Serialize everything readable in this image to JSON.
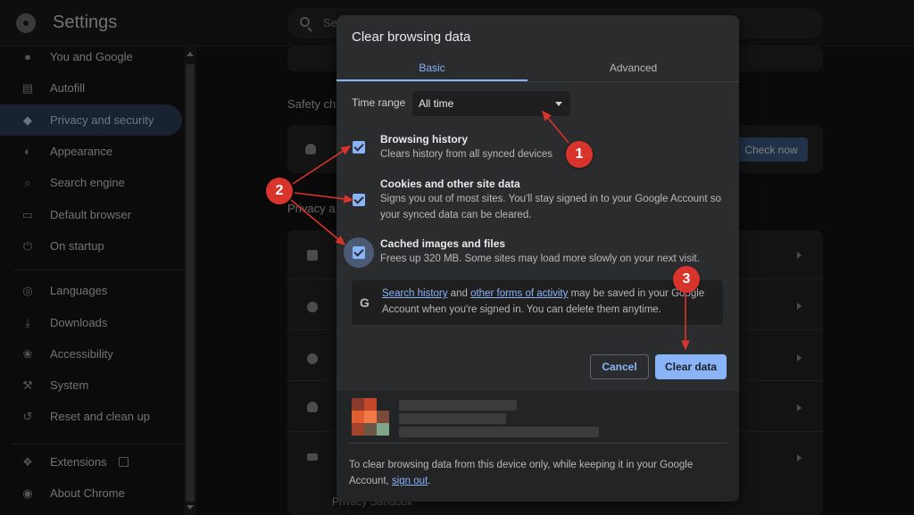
{
  "app": {
    "title": "Settings",
    "search_placeholder": "Search settings"
  },
  "sidebar": {
    "items": [
      {
        "label": "You and Google",
        "icon": "person-icon"
      },
      {
        "label": "Autofill",
        "icon": "clipboard-icon"
      },
      {
        "label": "Privacy and security",
        "icon": "shield-icon",
        "active": true
      },
      {
        "label": "Appearance",
        "icon": "palette-icon"
      },
      {
        "label": "Search engine",
        "icon": "search-icon"
      },
      {
        "label": "Default browser",
        "icon": "browser-icon"
      },
      {
        "label": "On startup",
        "icon": "power-icon"
      },
      {
        "label": "Languages",
        "icon": "globe-icon"
      },
      {
        "label": "Downloads",
        "icon": "download-icon"
      },
      {
        "label": "Accessibility",
        "icon": "accessibility-icon"
      },
      {
        "label": "System",
        "icon": "wrench-icon"
      },
      {
        "label": "Reset and clean up",
        "icon": "history-icon"
      },
      {
        "label": "Extensions",
        "icon": "puzzle-icon"
      },
      {
        "label": "About Chrome",
        "icon": "chrome-icon"
      }
    ]
  },
  "background": {
    "safety_check_heading": "Safety ch",
    "check_now_label": "Check now",
    "privacy_heading": "Privacy a",
    "privacy_sandbox_label": "Privacy Sandbox"
  },
  "dialog": {
    "title": "Clear browsing data",
    "tabs": [
      "Basic",
      "Advanced"
    ],
    "active_tab": "Basic",
    "time_range_label": "Time range",
    "time_range_value": "All time",
    "options": [
      {
        "title": "Browsing history",
        "desc": "Clears history from all synced devices",
        "checked": true
      },
      {
        "title": "Cookies and other site data",
        "desc": "Signs you out of most sites. You'll stay signed in to your Google Account so your synced data can be cleared.",
        "checked": true
      },
      {
        "title": "Cached images and files",
        "desc": "Frees up 320 MB. Some sites may load more slowly on your next visit.",
        "checked": true
      }
    ],
    "info": {
      "link1": "Search history",
      "mid1": " and ",
      "link2": "other forms of activity",
      "rest": " may be saved in your Google Account when you're signed in. You can delete them anytime."
    },
    "cancel_label": "Cancel",
    "clear_label": "Clear data",
    "footer_text": "To clear browsing data from this device only, while keeping it in your Google Account, ",
    "footer_link": "sign out",
    "footer_end": "."
  },
  "annotations": [
    "1",
    "2",
    "3"
  ],
  "colors": {
    "accent": "#8ab4f8",
    "annotation_red": "#d9342b",
    "active_nav_bg": "#2c3f58"
  }
}
